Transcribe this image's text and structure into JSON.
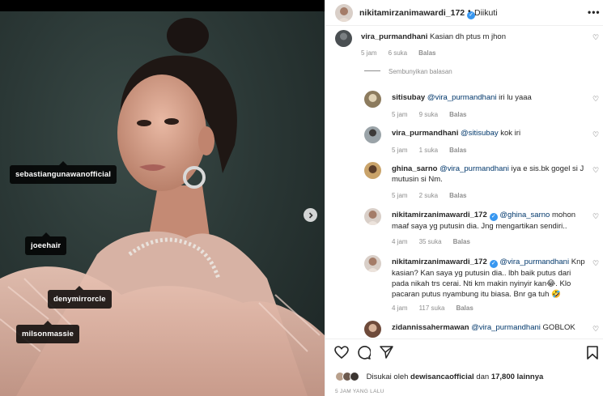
{
  "post": {
    "username": "nikitamirzanimawardi_172",
    "follow_status": "Diikuti",
    "separator": "•",
    "more": "•••"
  },
  "photo_tags": [
    "sebastiangunawanofficial",
    "joeehair",
    "denymirrorcle",
    "milsonmassie"
  ],
  "comments": [
    {
      "user": "vira_purmandhani",
      "mention": "",
      "text": "Kasian dh ptus m jhon",
      "time": "5 jam",
      "likes": "6 suka",
      "reply": "Balas"
    },
    {
      "user": "sitisubay",
      "mention": "@vira_purmandhani",
      "text": "iri lu yaaa",
      "time": "5 jam",
      "likes": "9 suka",
      "reply": "Balas"
    },
    {
      "user": "vira_purmandhani",
      "mention": "@sitisubay",
      "text": "kok iri",
      "time": "5 jam",
      "likes": "1 suka",
      "reply": "Balas"
    },
    {
      "user": "ghina_sarno",
      "mention": "@vira_purmandhani",
      "text": "iya e sis.bk gogel si J mutusin si Nm.",
      "time": "5 jam",
      "likes": "2 suka",
      "reply": "Balas"
    },
    {
      "user": "nikitamirzanimawardi_172",
      "mention": "@ghina_sarno",
      "text": "mohon maaf saya yg putusin dia. Jng mengartikan sendiri..",
      "time": "4 jam",
      "likes": "35 suka",
      "reply": "Balas"
    },
    {
      "user": "nikitamirzanimawardi_172",
      "mention": "@vira_purmandhani",
      "text": "Knp kasian? Kan saya yg putusin dia.. lbh baik putus dari pada nikah trs cerai. Nti km makin nyinyir kan😂. Klo pacaran putus nyambung itu biasa. Bnr ga tuh 🤣",
      "time": "4 jam",
      "likes": "117 suka",
      "reply": "Balas"
    },
    {
      "user": "zidannissahermawan",
      "mention": "@vira_purmandhani",
      "text": "GOBLOK",
      "time": "",
      "likes": "",
      "reply": ""
    }
  ],
  "hide_replies_label": "Sembunyikan balasan",
  "likes": {
    "prefix": "Disukai oleh",
    "user": "dewisancaofficial",
    "middle": "dan",
    "count": "17,800 lainnya"
  },
  "timestamp": "5 JAM YANG LALU",
  "icons": [
    "heart-icon",
    "comment-icon",
    "share-icon",
    "bookmark-icon",
    "verified-badge-icon",
    "chevron-right-icon",
    "more-icon"
  ],
  "colors": {
    "verified": "#3897f0",
    "mention": "#00376b",
    "muted": "#8e8e8e"
  }
}
